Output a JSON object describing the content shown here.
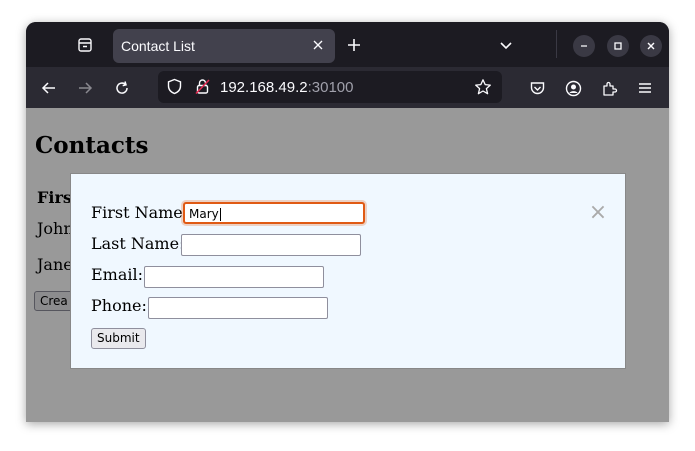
{
  "browser": {
    "tab_title": "Contact List",
    "url_host": "192.168.49.2",
    "url_port": ":30100"
  },
  "page": {
    "heading": "Contacts",
    "column_header": "Firs",
    "rows": [
      "John",
      "Jane"
    ],
    "create_button": "Crea"
  },
  "modal": {
    "close_symbol": "×",
    "fields": [
      {
        "label": "First Name:",
        "value": "Mary"
      },
      {
        "label": "Last Name:",
        "value": ""
      },
      {
        "label": "Email:",
        "value": ""
      },
      {
        "label": "Phone:",
        "value": ""
      }
    ],
    "submit_label": "Submit"
  },
  "colors": {
    "focus_ring": "#e05a14",
    "modal_background": "#f0f8ff",
    "toolbar": "#2b2a33"
  }
}
